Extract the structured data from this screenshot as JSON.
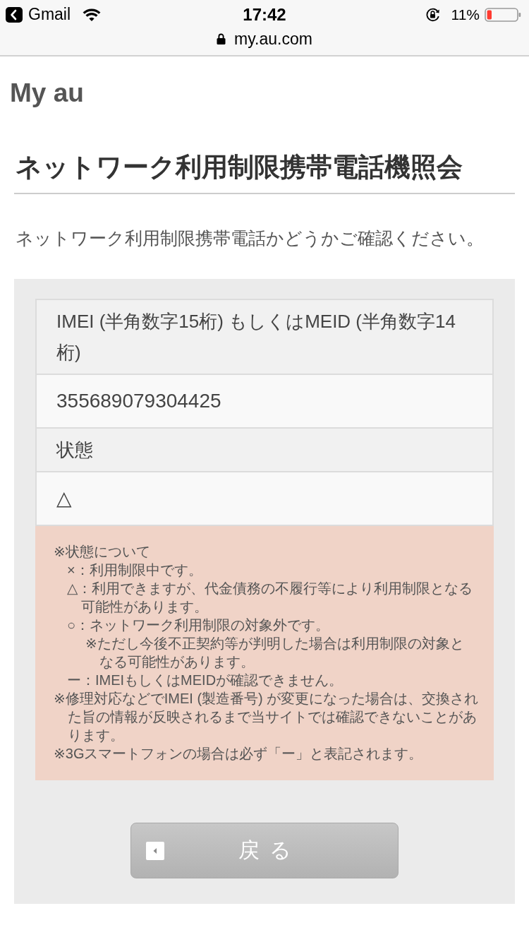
{
  "status_bar": {
    "back_app": "Gmail",
    "time": "17:42",
    "battery": "11%",
    "url": "my.au.com"
  },
  "logo": "My au",
  "page_title": "ネットワーク利用制限携帯電話機照会",
  "intro": "ネットワーク利用制限携帯電話かどうかご確認ください。",
  "result_table": {
    "rows": [
      {
        "label": "IMEI (半角数字15桁) もしくはMEID (半角数字14桁)",
        "value": "355689079304425"
      },
      {
        "label": "状態",
        "value": "△"
      }
    ]
  },
  "notes": [
    {
      "text": "※状態について",
      "children": [
        {
          "text": "×：利用制限中です。"
        },
        {
          "text": "△：利用できますが、代金債務の不履行等により利用制限となる可能性があります。"
        },
        {
          "text": "○：ネットワーク利用制限の対象外です。",
          "children": [
            {
              "text": "※ただし今後不正契約等が判明した場合は利用制限の対象となる可能性があります。"
            }
          ]
        },
        {
          "text": "ー：IMEIもしくはMEIDが確認できません。"
        }
      ]
    },
    {
      "text": "※修理対応などでIMEI (製造番号) が変更になった場合は、交換された旨の情報が反映されるまで当サイトでは確認できないことがあります。"
    },
    {
      "text": "※3Gスマートフォンの場合は必ず「ー」と表記されます。"
    }
  ],
  "back_button": {
    "label": "戻る"
  }
}
